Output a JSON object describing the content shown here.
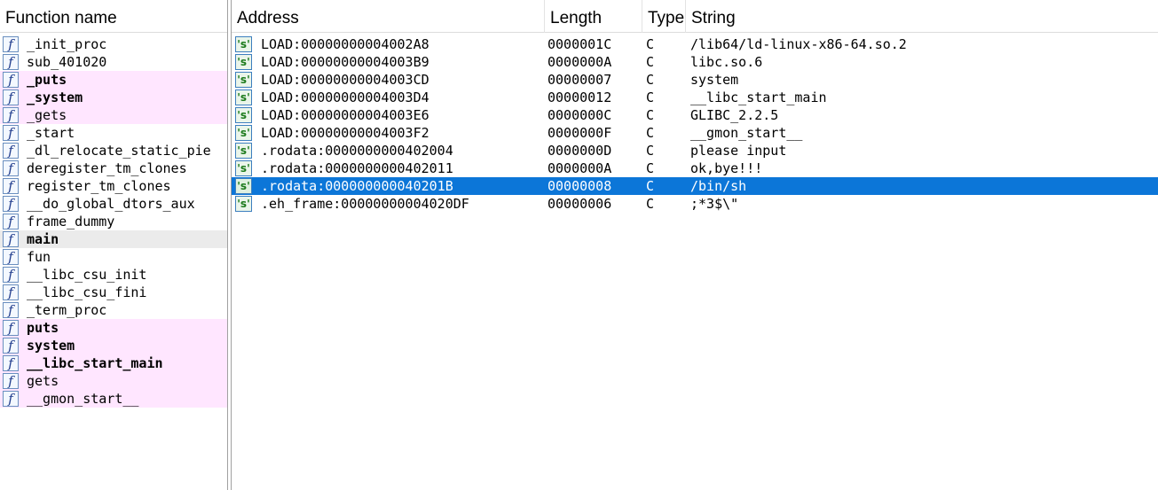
{
  "functions": {
    "header": "Function name",
    "items": [
      {
        "name": "_init_proc",
        "style": ""
      },
      {
        "name": "sub_401020",
        "style": ""
      },
      {
        "name": "_puts",
        "style": "pink bold"
      },
      {
        "name": "_system",
        "style": "pink bold"
      },
      {
        "name": "_gets",
        "style": "pink"
      },
      {
        "name": "_start",
        "style": ""
      },
      {
        "name": "_dl_relocate_static_pie",
        "style": ""
      },
      {
        "name": "deregister_tm_clones",
        "style": ""
      },
      {
        "name": "register_tm_clones",
        "style": ""
      },
      {
        "name": "__do_global_dtors_aux",
        "style": ""
      },
      {
        "name": "frame_dummy",
        "style": ""
      },
      {
        "name": "main",
        "style": "gray bold"
      },
      {
        "name": "fun",
        "style": ""
      },
      {
        "name": "__libc_csu_init",
        "style": ""
      },
      {
        "name": "__libc_csu_fini",
        "style": ""
      },
      {
        "name": "_term_proc",
        "style": ""
      },
      {
        "name": "puts",
        "style": "pink bold"
      },
      {
        "name": "system",
        "style": "pink bold"
      },
      {
        "name": "__libc_start_main",
        "style": "pink bold"
      },
      {
        "name": "gets",
        "style": "pink"
      },
      {
        "name": "__gmon_start__",
        "style": "pink"
      }
    ]
  },
  "strings": {
    "headers": {
      "address": "Address",
      "length": "Length",
      "type": "Type",
      "string": "String"
    },
    "rows": [
      {
        "address": "LOAD:00000000004002A8",
        "length": "0000001C",
        "type": "C",
        "string": "/lib64/ld-linux-x86-64.so.2",
        "selected": false
      },
      {
        "address": "LOAD:00000000004003B9",
        "length": "0000000A",
        "type": "C",
        "string": "libc.so.6",
        "selected": false
      },
      {
        "address": "LOAD:00000000004003CD",
        "length": "00000007",
        "type": "C",
        "string": "system",
        "selected": false
      },
      {
        "address": "LOAD:00000000004003D4",
        "length": "00000012",
        "type": "C",
        "string": "__libc_start_main",
        "selected": false
      },
      {
        "address": "LOAD:00000000004003E6",
        "length": "0000000C",
        "type": "C",
        "string": "GLIBC_2.2.5",
        "selected": false
      },
      {
        "address": "LOAD:00000000004003F2",
        "length": "0000000F",
        "type": "C",
        "string": "__gmon_start__",
        "selected": false
      },
      {
        "address": ".rodata:0000000000402004",
        "length": "0000000D",
        "type": "C",
        "string": "please input",
        "selected": false
      },
      {
        "address": ".rodata:0000000000402011",
        "length": "0000000A",
        "type": "C",
        "string": "ok,bye!!!",
        "selected": false
      },
      {
        "address": ".rodata:000000000040201B",
        "length": "00000008",
        "type": "C",
        "string": "/bin/sh",
        "selected": true
      },
      {
        "address": ".eh_frame:00000000004020DF",
        "length": "00000006",
        "type": "C",
        "string": ";*3$\\\"",
        "selected": false
      }
    ]
  },
  "icons": {
    "function_glyph": "f",
    "string_glyph": "'s'"
  },
  "colors": {
    "selection": "#0c76d8",
    "import_highlight": "#ffe6ff",
    "current_function": "#ebebeb"
  }
}
